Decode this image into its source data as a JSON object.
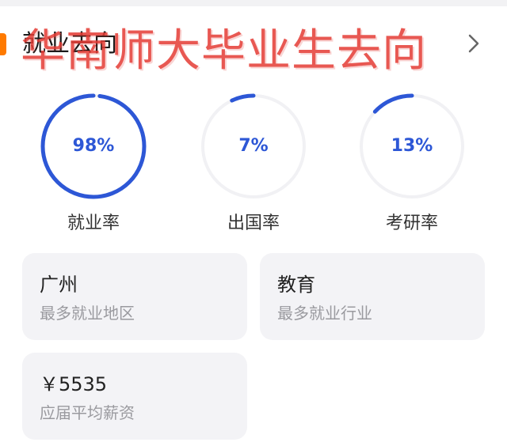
{
  "section": {
    "title": "就业去向",
    "overlay_title": "华南师大毕业生去向"
  },
  "colors": {
    "accent": "#ff7a00",
    "ring_progress": "#2d57d6",
    "ring_track": "#f1f1f4",
    "overlay_text": "#e53b35",
    "card_bg": "#f3f3f6"
  },
  "stats": [
    {
      "percent_text": "98%",
      "label": "就业率",
      "fraction": 0.98
    },
    {
      "percent_text": "7%",
      "label": "出国率",
      "fraction": 0.07
    },
    {
      "percent_text": "13%",
      "label": "考研率",
      "fraction": 0.13
    }
  ],
  "cards": [
    {
      "value": "广州",
      "desc": "最多就业地区"
    },
    {
      "value": "教育",
      "desc": "最多就业行业"
    },
    {
      "value": "￥5535",
      "desc": "应届平均薪资"
    }
  ]
}
